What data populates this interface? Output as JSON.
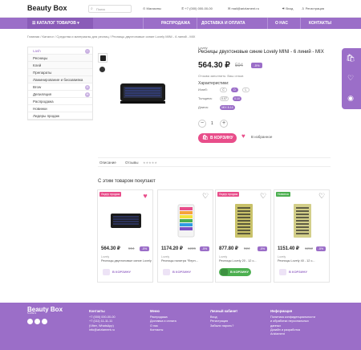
{
  "header": {
    "logo": "Beauty Box",
    "search_placeholder": "Поиск",
    "city": "Магазины",
    "phone": "+7 (000) 000-00-00",
    "email": "mail@arizlament.ru",
    "login": "Вход",
    "register": "Регистрация"
  },
  "nav": {
    "catalog": "КАТАЛОГ ТОВАРОВ",
    "items": [
      "РАСПРОДАЖА",
      "ДОСТАВКА И ОПЛАТА",
      "О НАС",
      "КОНТАКТЫ"
    ]
  },
  "breadcrumbs": "Главная / Каталог / Средства и материалы для ресниц / Ресницы двухтоновые синие Lovely MINI - 6 линий - MIX",
  "sidebar": [
    {
      "label": "Lash",
      "plus": true,
      "active": true
    },
    {
      "label": "Ресницы",
      "sub": true
    },
    {
      "label": "Клей",
      "sub": true
    },
    {
      "label": "Препараты",
      "sub": true
    },
    {
      "label": "Ламинирование и биозавивка",
      "sub": true
    },
    {
      "label": "Brow",
      "plus": true
    },
    {
      "label": "Депиляция",
      "plus": true
    },
    {
      "label": "Распродажа"
    },
    {
      "label": "Новинки"
    },
    {
      "label": "Лидеры продаж"
    }
  ],
  "product": {
    "brand": "Lovely",
    "title": "Ресницы двухтоновые синие Lovely MINI - 6 линий - MIX",
    "price": "564.30 ₽",
    "old_price": "594",
    "discount": "-5%",
    "note": "Отзыва заполнить: Ваш отзыв",
    "characteristics": "Характеристики:",
    "bend_label": "Изгиб:",
    "bend": [
      "C",
      "D",
      "L"
    ],
    "thickness_label": "Толщина:",
    "thickness": [
      "0.07",
      "0.10"
    ],
    "length_label": "Длина:",
    "length": [
      "MIX 8-14"
    ],
    "qty": "1",
    "cart_label": "В КОРЗИНУ",
    "fav_label": "В избранное"
  },
  "tabs": {
    "desc": "Описание",
    "reviews": "Отзывы"
  },
  "section_title": "С этим товаром покупают",
  "cards": [
    {
      "badge": "Лидер продаж",
      "badge_color": "#e84d8a",
      "heart": "♥",
      "heart_color": "#e84d8a",
      "price": "564.30 ₽",
      "old": "594",
      "disc": "-5%",
      "brand": "Lovely",
      "name": "Ресницы двухтоновые синие Lovely MINI",
      "cart": "В КОРЗИНУ",
      "green": false
    },
    {
      "badge": "",
      "badge_color": "",
      "heart": "♡",
      "heart_color": "#555",
      "price": "1174.20 ₽",
      "old": "1236",
      "disc": "-5%",
      "brand": "Lovely",
      "name": "Ресницы палитра \"Ферн...",
      "cart": "В КОРЗИНУ",
      "green": false
    },
    {
      "badge": "Лидер продаж",
      "badge_color": "#e84d8a",
      "heart": "♡",
      "heart_color": "#555",
      "price": "877.80 ₽",
      "old": "924",
      "disc": "-5%",
      "brand": "Lovely",
      "name": "Ресницы Lovely 20 - 12 с...",
      "cart": "В КОРЗИНУ",
      "green": true
    },
    {
      "badge": "Новинка",
      "badge_color": "#4caf50",
      "heart": "♡",
      "heart_color": "#555",
      "price": "1151.40 ₽",
      "old": "1212",
      "disc": "-5%",
      "brand": "Lovely",
      "name": "Ресницы Lovely 40 - 12 с...",
      "cart": "В КОРЗИНУ",
      "green": false
    }
  ],
  "footer": {
    "logo": "Beauty Box",
    "year": "©2021",
    "contacts_h": "Контакты",
    "contacts": [
      "+7 (000) 000-00-00",
      "+7 (111) 11-11-11",
      "(Viber, WhatsApp)",
      "info@arizlament.ru"
    ],
    "menu_h": "Меню",
    "menu": [
      "Распродажа",
      "Доставка и оплата",
      "О нас",
      "Контакты"
    ],
    "cabinet_h": "Личный кабинет",
    "cabinet": [
      "Вход",
      "Регистрация",
      "Забыли пароль?"
    ],
    "info_h": "Информация",
    "info": [
      "Политика конфиденциальности",
      "и обработки персональных",
      "данных",
      "Дизайн и разработка",
      "Arizlament"
    ]
  },
  "colors": {
    "accent": "#9b6ec8",
    "pink": "#e84d8a",
    "green": "#4caf50"
  }
}
